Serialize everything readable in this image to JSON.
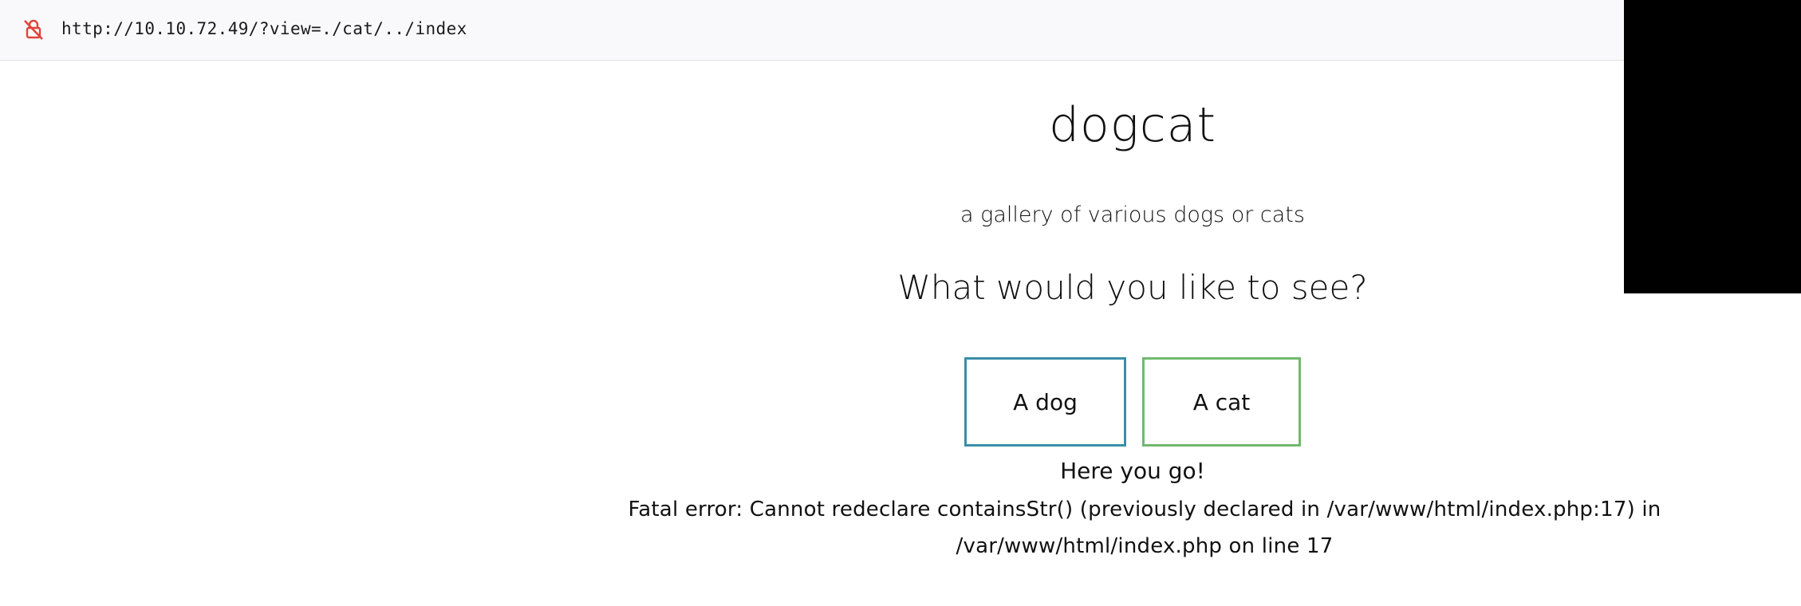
{
  "browser": {
    "url": "http://10.10.72.49/?view=./cat/../index",
    "lock_icon": "insecure-lock-icon"
  },
  "page": {
    "title": "dogcat",
    "subtitle": "a gallery of various dogs or cats",
    "question": "What would you like to see?",
    "buttons": {
      "dog": "A dog",
      "cat": "A cat"
    },
    "result_text": "Here you go!",
    "error_text": "Fatal error: Cannot redeclare containsStr() (previously declared in /var/www/html/index.php:17) in /var/www/html/index.php on line 17"
  },
  "colors": {
    "dog_button_border": "#3a8ea9",
    "cat_button_border": "#6fb96d",
    "insecure_icon": "#e0443a"
  }
}
